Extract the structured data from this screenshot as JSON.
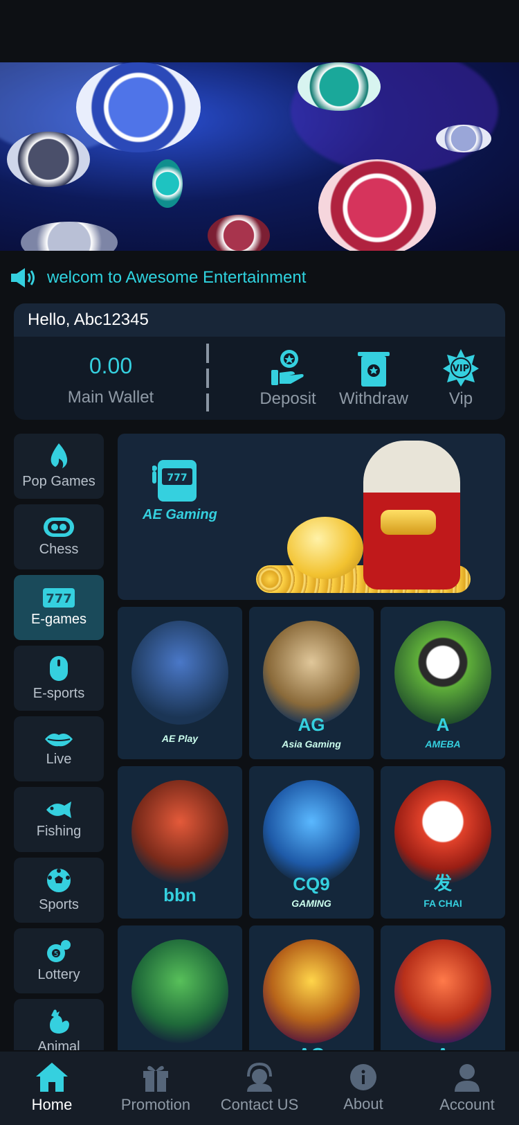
{
  "marquee": {
    "text": "welcom to Awesome Entertainment"
  },
  "wallet": {
    "greeting": "Hello, Abc12345",
    "amount": "0.00",
    "amount_label": "Main Wallet",
    "actions": [
      {
        "label": "Deposit",
        "icon": "deposit-hand-icon"
      },
      {
        "label": "Withdraw",
        "icon": "withdraw-card-icon"
      },
      {
        "label": "Vip",
        "icon": "vip-badge-icon"
      }
    ]
  },
  "categories": [
    {
      "label": "Pop Games",
      "icon": "fire-icon"
    },
    {
      "label": "Chess",
      "icon": "cards-icon"
    },
    {
      "label": "E-games",
      "icon": "slot-777-icon",
      "active": true
    },
    {
      "label": "E-sports",
      "icon": "mouse-icon"
    },
    {
      "label": "Live",
      "icon": "lips-icon"
    },
    {
      "label": "Fishing",
      "icon": "fish-icon"
    },
    {
      "label": "Sports",
      "icon": "soccer-ball-icon"
    },
    {
      "label": "Lottery",
      "icon": "lottery-balls-icon"
    },
    {
      "label": "Animal",
      "icon": "rooster-icon"
    }
  ],
  "banner": {
    "brand": "AE Gaming",
    "slot_digits": "777"
  },
  "games": [
    {
      "brand": "AE Play"
    },
    {
      "brand": "AG",
      "sub": "Asia Gaming"
    },
    {
      "brand": "A",
      "sub": "AMEBA"
    },
    {
      "brand": "bbn"
    },
    {
      "brand": "CQ9",
      "sub": "GAMING"
    },
    {
      "brand": "发",
      "sub": "FA CHAI"
    },
    {
      "brand": ""
    },
    {
      "brand": "AG"
    },
    {
      "brand": "A"
    }
  ],
  "tabs": [
    {
      "label": "Home",
      "icon": "home-icon",
      "active": true
    },
    {
      "label": "Promotion",
      "icon": "gift-icon"
    },
    {
      "label": "Contact US",
      "icon": "headset-agent-icon"
    },
    {
      "label": "About",
      "icon": "info-icon"
    },
    {
      "label": "Account",
      "icon": "user-icon"
    }
  ],
  "colors": {
    "accent": "#35d0df",
    "bg": "#0d1014",
    "panel": "#111a26",
    "active_tab": "#1a4a5a"
  }
}
